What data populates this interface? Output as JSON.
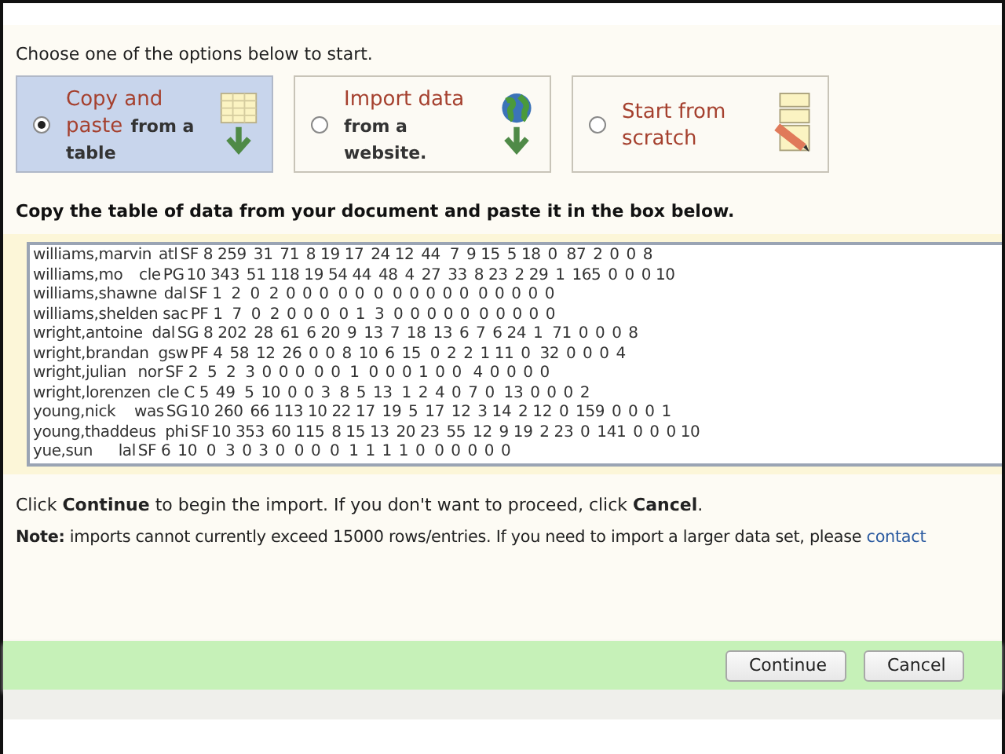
{
  "intro": "Choose one of the options below to start.",
  "options": [
    {
      "title": "Copy and paste",
      "subtitle": "from a table",
      "selected": true,
      "kind": "table"
    },
    {
      "title": "Import data",
      "subtitle": "from a website.",
      "selected": false,
      "kind": "web"
    },
    {
      "title": "Start from scratch",
      "selected": false,
      "kind": "scratch"
    }
  ],
  "paste_heading": "Copy the table of data from your document and paste it in the box below.",
  "pasted_rows": [
    "williams,marvin   atl SF  8  259   31   71   8  19  17   24  12   44    7   9  15   5  18   0    87   2   0   0   8",
    "williams,mo       cle PG 10  343   51  118  19  54  44   48   4   27   33   8  23   2  29   1   165   0   0   0  10",
    "williams,shawne   dal SF  1    2    0    2   0   0   0    0   0    0    0   0   0   0   0    0   0   0   0   0",
    "williams,shelden  sac PF  1    7    0    2   0   0   0    0   1    3    0   0   0   0   0    0   0   0   0   0",
    "wright,antoine    dal SG  8  202   28   61   6  20   9   13   7   18   13   6   7   6  24   1    71   0   0   0   8",
    "wright,brandan    gsw PF  4   58   12   26   0   0   8   10   6   15    0   2   2   1  11   0    32   0   0   0   4",
    "wright,julian     nor SF  2    5    2    3   0   0   0    0   0    1    0   0   0   1   0   0     4   0   0   0   0",
    "wright,lorenzen   cle  C  5   49    5   10   0   0   3    8   5   13    1   2   4   0   7   0    13   0   0   0   2",
    "young,nick        was SG 10  260   66  113  10  22  17   19   5   17   12   3  14   2  12   0   159   0   0   0   1",
    "young,thaddeus    phi SF 10  353   60  115   8  15  13   20  23   55   12   9  19   2  23   0   141   0   0   0  10",
    "yue,sun           lal SF  6   10    0    3   0   3   0    0   0    0    1   1   1   1   0    0   0   0   0   0"
  ],
  "instruction": "Click **Continue** to begin the import. If you don't want to proceed, click **Cancel**.",
  "note": "**Note:** imports cannot currently exceed 15000 rows/entries. If you need to import a larger data set, please",
  "note_link": "contact",
  "buttons": [
    "Continue",
    "Cancel"
  ]
}
